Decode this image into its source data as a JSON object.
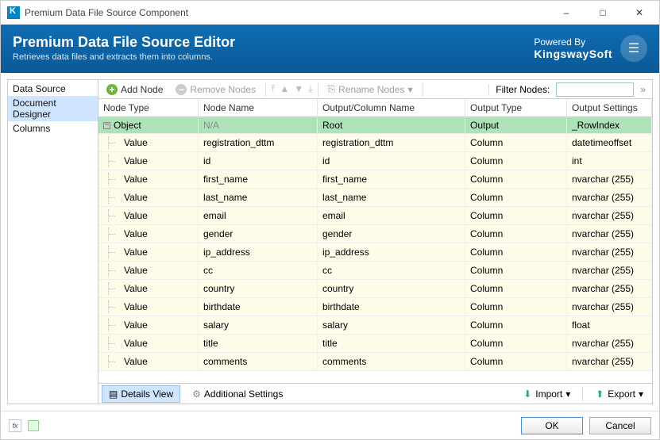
{
  "window": {
    "title": "Premium Data File Source Component"
  },
  "header": {
    "title": "Premium Data File Source Editor",
    "subtitle": "Retrieves data files and extracts them into columns.",
    "poweredBy": "Powered By",
    "brand": "KingswaySoft"
  },
  "sidebar": {
    "items": [
      {
        "label": "Data Source",
        "selected": false
      },
      {
        "label": "Document Designer",
        "selected": true
      },
      {
        "label": "Columns",
        "selected": false
      }
    ]
  },
  "toolbar": {
    "addNode": "Add Node",
    "removeNodes": "Remove Nodes",
    "renameNodes": "Rename Nodes",
    "filterLabel": "Filter Nodes:",
    "filterValue": ""
  },
  "grid": {
    "headers": {
      "nodeType": "Node Type",
      "nodeName": "Node Name",
      "outputColumn": "Output/Column Name",
      "outputType": "Output Type",
      "outputSettings": "Output Settings"
    },
    "rows": [
      {
        "type": "Object",
        "name": "N/A",
        "col": "Root",
        "otype": "Output",
        "settings": "_RowIndex",
        "root": true
      },
      {
        "type": "Value",
        "name": "registration_dttm",
        "col": "registration_dttm",
        "otype": "Column",
        "settings": "datetimeoffset"
      },
      {
        "type": "Value",
        "name": "id",
        "col": "id",
        "otype": "Column",
        "settings": "int"
      },
      {
        "type": "Value",
        "name": "first_name",
        "col": "first_name",
        "otype": "Column",
        "settings": "nvarchar (255)"
      },
      {
        "type": "Value",
        "name": "last_name",
        "col": "last_name",
        "otype": "Column",
        "settings": "nvarchar (255)"
      },
      {
        "type": "Value",
        "name": "email",
        "col": "email",
        "otype": "Column",
        "settings": "nvarchar (255)"
      },
      {
        "type": "Value",
        "name": "gender",
        "col": "gender",
        "otype": "Column",
        "settings": "nvarchar (255)"
      },
      {
        "type": "Value",
        "name": "ip_address",
        "col": "ip_address",
        "otype": "Column",
        "settings": "nvarchar (255)"
      },
      {
        "type": "Value",
        "name": "cc",
        "col": "cc",
        "otype": "Column",
        "settings": "nvarchar (255)"
      },
      {
        "type": "Value",
        "name": "country",
        "col": "country",
        "otype": "Column",
        "settings": "nvarchar (255)"
      },
      {
        "type": "Value",
        "name": "birthdate",
        "col": "birthdate",
        "otype": "Column",
        "settings": "nvarchar (255)"
      },
      {
        "type": "Value",
        "name": "salary",
        "col": "salary",
        "otype": "Column",
        "settings": "float"
      },
      {
        "type": "Value",
        "name": "title",
        "col": "title",
        "otype": "Column",
        "settings": "nvarchar (255)"
      },
      {
        "type": "Value",
        "name": "comments",
        "col": "comments",
        "otype": "Column",
        "settings": "nvarchar (255)"
      }
    ]
  },
  "bottom": {
    "detailsView": "Details View",
    "additionalSettings": "Additional Settings",
    "import": "Import",
    "export": "Export"
  },
  "footer": {
    "ok": "OK",
    "cancel": "Cancel"
  }
}
